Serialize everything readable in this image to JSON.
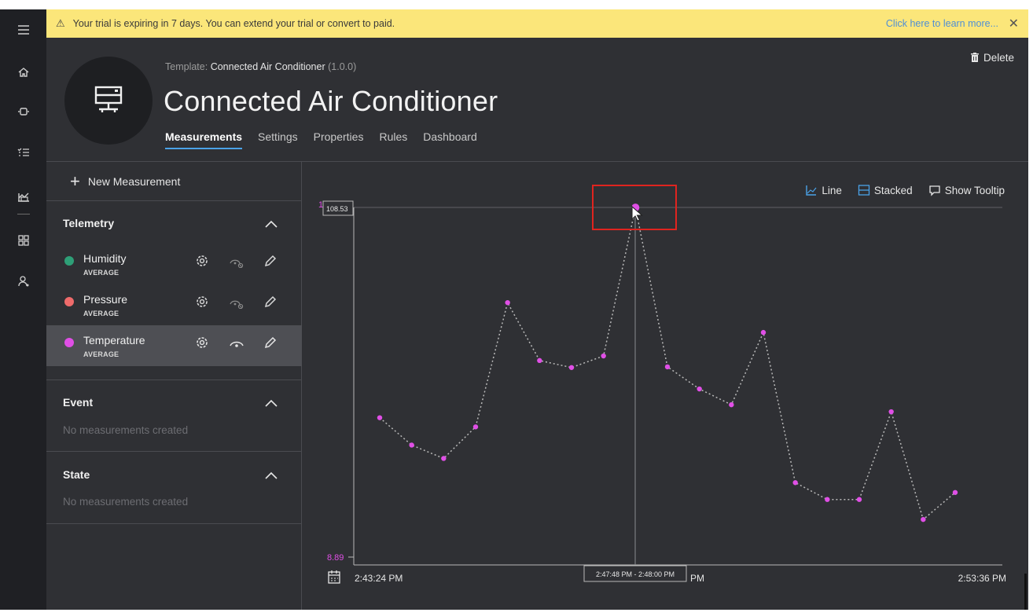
{
  "banner": {
    "message": "Your trial is expiring in 7 days. You can extend your trial or convert to paid.",
    "learn_more": "Click here to learn more...",
    "close": "✕"
  },
  "header": {
    "template_label": "Template:",
    "template_name": "Connected Air Conditioner",
    "template_version": "(1.0.0)",
    "title": "Connected Air Conditioner",
    "delete_label": "Delete"
  },
  "tabs": [
    {
      "label": "Measurements",
      "active": true
    },
    {
      "label": "Settings",
      "active": false
    },
    {
      "label": "Properties",
      "active": false
    },
    {
      "label": "Rules",
      "active": false
    },
    {
      "label": "Dashboard",
      "active": false
    }
  ],
  "panel": {
    "new_measurement": "New Measurement",
    "sections": {
      "telemetry": {
        "title": "Telemetry",
        "items": [
          {
            "name": "Humidity",
            "aggregation": "AVERAGE",
            "color": "#2e9f77",
            "visible": false
          },
          {
            "name": "Pressure",
            "aggregation": "AVERAGE",
            "color": "#ef6b6b",
            "visible": false
          },
          {
            "name": "Temperature",
            "aggregation": "AVERAGE",
            "color": "#e04fe6",
            "visible": true
          }
        ]
      },
      "event": {
        "title": "Event",
        "empty": "No measurements created"
      },
      "state": {
        "title": "State",
        "empty": "No measurements created"
      }
    }
  },
  "toolbar": {
    "line": "Line",
    "stacked": "Stacked",
    "show_tooltip": "Show Tooltip"
  },
  "chart_data": {
    "type": "line",
    "title": "",
    "xlabel": "",
    "ylabel": "",
    "x_start": "2:43:24 PM",
    "x_end": "2:53:36 PM",
    "y_min_label": "8.89",
    "y_top_label": "1",
    "hover_value": "108.53",
    "hover_range": "2:47:48 PM - 2:48:00 PM",
    "hover_suffix": "PM",
    "ylim": [
      8.89,
      108.53
    ],
    "series": [
      {
        "color": "#e04fe6",
        "values": [
          48.6,
          40.8,
          37.0,
          46.0,
          81.4,
          64.9,
          62.9,
          66.2,
          108.5,
          63.1,
          56.8,
          52.3,
          72.9,
          30.1,
          25.3,
          25.3,
          50.3,
          19.6,
          27.3
        ]
      }
    ]
  },
  "colors": {
    "banner": "#fbe67a",
    "background": "#2f3034",
    "rail": "#1f2024",
    "accent": "#4aa2e8",
    "highlight": "#e0241f"
  }
}
